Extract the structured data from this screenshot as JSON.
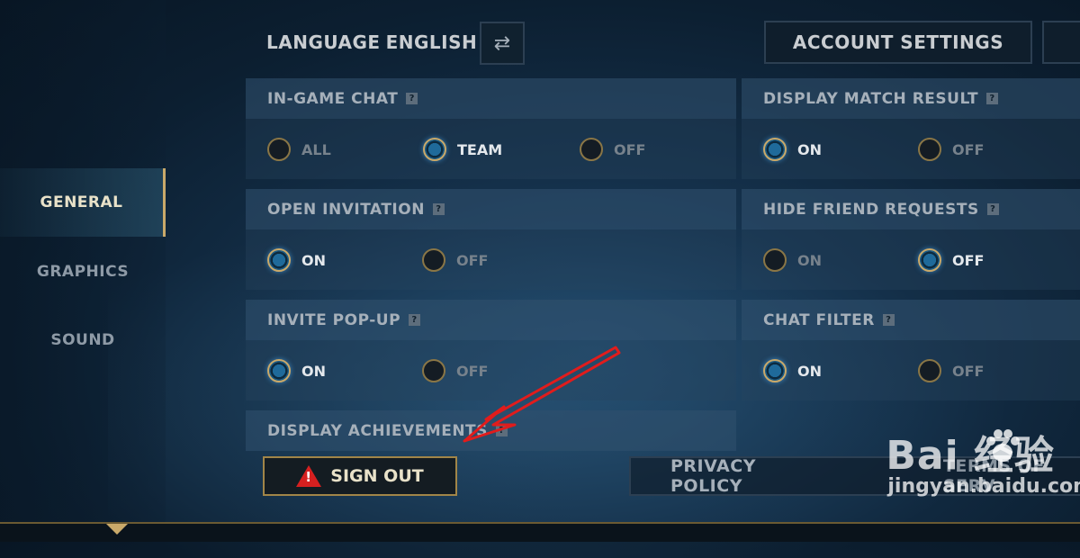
{
  "sidebar": {
    "items": [
      {
        "label": "GENERAL",
        "active": true
      },
      {
        "label": "GRAPHICS",
        "active": false
      },
      {
        "label": "SOUND",
        "active": false
      }
    ]
  },
  "header": {
    "language_label": "LANGUAGE",
    "language_value": "ENGLISH",
    "swap_icon": "swap-arrows-icon",
    "account_settings": "ACCOUNT SETTINGS"
  },
  "settings": {
    "in_game_chat": {
      "title": "IN-GAME CHAT",
      "options": [
        "ALL",
        "TEAM",
        "OFF"
      ],
      "selected": "TEAM"
    },
    "display_match_result": {
      "title": "DISPLAY MATCH RESULT",
      "options": [
        "ON",
        "OFF"
      ],
      "selected": "ON"
    },
    "open_invitation": {
      "title": "OPEN INVITATION",
      "options": [
        "ON",
        "OFF"
      ],
      "selected": "ON"
    },
    "hide_friend_requests": {
      "title": "HIDE FRIEND REQUESTS",
      "options": [
        "ON",
        "OFF"
      ],
      "selected": "OFF"
    },
    "invite_popup": {
      "title": "INVITE POP-UP",
      "options": [
        "ON",
        "OFF"
      ],
      "selected": "ON"
    },
    "chat_filter": {
      "title": "CHAT FILTER",
      "options": [
        "ON",
        "OFF"
      ],
      "selected": "ON"
    },
    "display_achievements": {
      "title": "DISPLAY ACHIEVEMENTS"
    }
  },
  "footer": {
    "sign_out": "SIGN OUT",
    "privacy_policy": "PRIVACY POLICY",
    "terms_partial": "TERMS OF SERV"
  },
  "watermark": {
    "brand": "Bai  经验",
    "url": "jingyan.baidu.com"
  },
  "colors": {
    "accent_gold": "#c9a96a",
    "radio_on_blue": "#1f6a9a",
    "warning_red": "#d62020"
  }
}
